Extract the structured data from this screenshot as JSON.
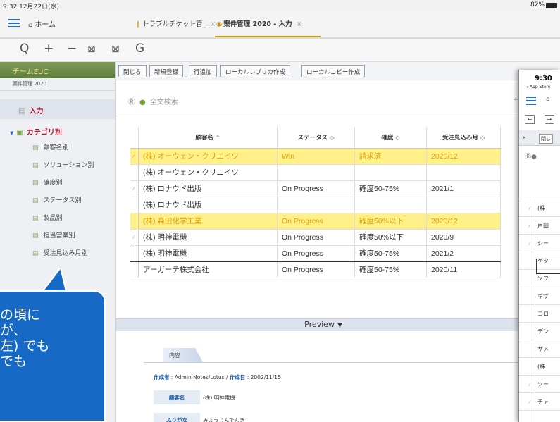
{
  "status_bar": {
    "time": "9:32  12月22日(水)",
    "battery": "82%"
  },
  "tab_bar": {
    "home": "ホーム",
    "tabs": [
      {
        "label": "トラブルチケット管_",
        "close": "×"
      },
      {
        "label": "案件管理 2020 - 入力",
        "close": "×"
      }
    ]
  },
  "toolbar": {
    "search": "Q",
    "zoom_in": "+",
    "zoom_out": "−",
    "reload": "G"
  },
  "sidebar": {
    "app_name": "チームEUC",
    "db_name": "案件管理 2020",
    "input_label": "入力",
    "category_label": "カテゴリ別",
    "items": [
      "顧客名別",
      "ソリューション別",
      "確度別",
      "ステータス別",
      "製品別",
      "担当営業別",
      "受注見込み月別"
    ]
  },
  "action_buttons": [
    "閉じる",
    "新規登録",
    "行追加",
    "ローカルレプリカ作成",
    "ローカルコピー作成"
  ],
  "search": {
    "placeholder": "全文検索"
  },
  "table": {
    "columns": [
      "顧客名",
      "ステータス",
      "確度",
      "受注見込み月"
    ],
    "rows": [
      [
        "(株) オーウェン・クリエイツ",
        "Win",
        "請求済",
        "2020/12"
      ],
      [
        "(株) オーウェン・クリエイツ",
        "",
        "",
        ""
      ],
      [
        "(株) ロナウド出版",
        "On Progress",
        "確度50-75%",
        "2021/1"
      ],
      [
        "(株) ロナウド出版",
        "",
        "",
        ""
      ],
      [
        "(株) 森田化学工業",
        "On Progress",
        "確度50%以下",
        "2020/12"
      ],
      [
        "(株) 明神電機",
        "On Progress",
        "確度50%以下",
        "2020/9"
      ],
      [
        "(株) 明神電機",
        "On Progress",
        "確度50-75%",
        "2021/2"
      ],
      [
        "アーガーテ株式会社",
        "On Progress",
        "確度50-75%",
        "2020/11"
      ]
    ]
  },
  "preview": {
    "label": "Preview"
  },
  "detail": {
    "tab": "内容",
    "created_by_label": "作成者",
    "created_by": "Admin Notes/Lotus",
    "created_date_label": "作成日",
    "created_date": "2002/11/15",
    "fields": [
      {
        "label": "顧客名",
        "value": "(株) 明神電機"
      },
      {
        "label": "ふりがな",
        "value": "みょうじんでんき"
      }
    ]
  },
  "overlay": {
    "time": "9:30",
    "back": "◂ App Store",
    "close_btn": "閉じ",
    "rows": [
      "(株",
      "戸田",
      "シー",
      "ゲタ",
      "ソフ",
      "ギザ",
      "コロ",
      "デン",
      "ザメ",
      "(株",
      "ツー",
      "チャ"
    ]
  },
  "callout": {
    "lines": [
      "の頃に",
      "が、",
      "左) でも",
      "でも"
    ]
  }
}
